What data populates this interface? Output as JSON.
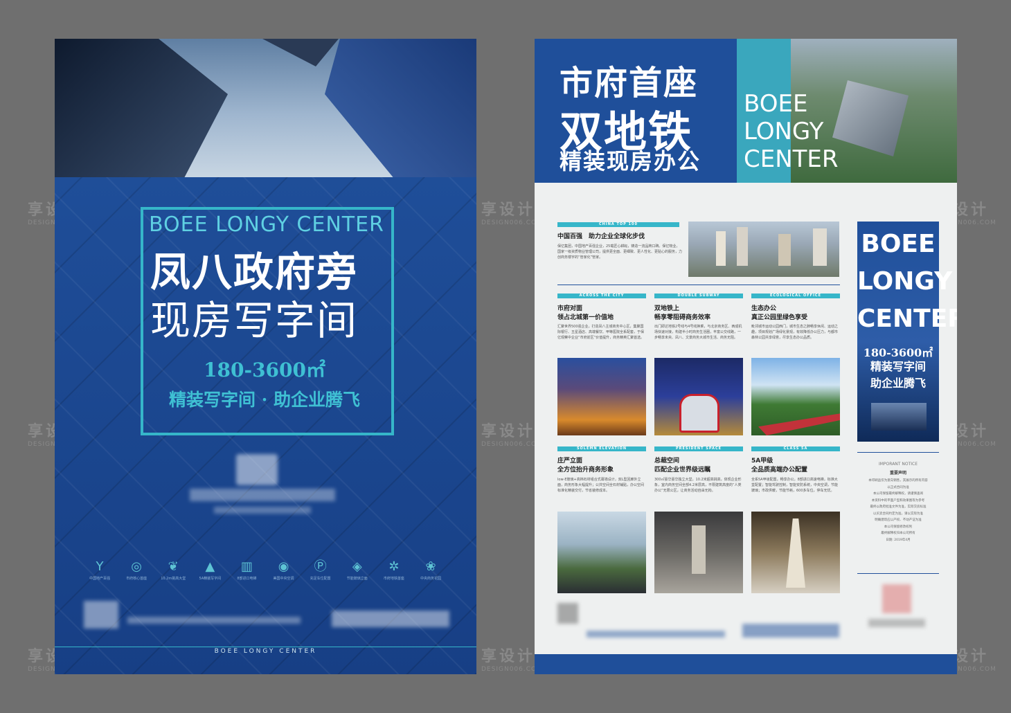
{
  "watermark": {
    "cn": "享设计",
    "en": "DESIGN006.COM"
  },
  "left_flyer": {
    "brand_en": "BOEE LONGY CENTER",
    "headline_1": "凤八政府旁",
    "headline_2": "现房写字间",
    "area": "180-3600㎡",
    "slogan": "精装写字间 · 助企业腾飞",
    "footer_brand": "BOEE LONGY CENTER",
    "icons": [
      {
        "icon": "y-shape-icon",
        "label": "中国地产百强"
      },
      {
        "icon": "grid-circle-icon",
        "label": "市府核心首座"
      },
      {
        "icon": "leaf-icon",
        "label": "10.2m挑高大堂"
      },
      {
        "icon": "triangles-icon",
        "label": "5A精装写字间"
      },
      {
        "icon": "building-icon",
        "label": "8部进口电梯"
      },
      {
        "icon": "target-icon",
        "label": "美国中央空调"
      },
      {
        "icon": "parking-icon",
        "label": "充足车位配置"
      },
      {
        "icon": "diamond-icon",
        "label": "节能玻璃立面"
      },
      {
        "icon": "stars-icon",
        "label": "市府地铁首座"
      },
      {
        "icon": "tree-icon",
        "label": "中央商务花园"
      }
    ]
  },
  "right_flyer": {
    "headline_1": "市府首座",
    "headline_2": "双地铁",
    "headline_3": "精装现房办公",
    "brand_en_1": "BOEE",
    "brand_en_2": "LONGY",
    "brand_en_3": "CENTER",
    "intro": {
      "bar": "CHINA TOP 100",
      "title": "中国百强　助力企业全球化步伐",
      "text": "保亿集团，中国地产百强企业，25载匠心耕耘，铸造一流品牌口碑。保亿物业，国家一级资质物业管理公司，提供更全面、更细致、更人性化、更贴心的服务，力创商务楼宇的“管家化”管家。"
    },
    "sections": [
      {
        "bar": "ACROSS THE CITY",
        "title1": "市府对面",
        "title2": "领占北城第一价值地",
        "text": "汇聚世界500强企业，打造凤八主城商务中心区，集聚国际银行、五星酒店、高端餐饮、甲等医院全系配套，于保亿观察中企业“市府前区”价值提升，商务精英汇聚首选。"
      },
      {
        "bar": "DOUBLE SUBWAY",
        "title1": "双地铁上",
        "title2": "畅享零阻碍商务效率",
        "text": "出门即达地铁2号线与4号线换乘，与北京商务区、西成机场快速对接，构建半小时商务生活圈，丰富公交线路，一步畅享未央、凤八、文景商务大城市生活、商务无阻。"
      },
      {
        "bar": "ECOLOGICAL OFFICE",
        "title1": "生态办公",
        "title2": "真正公园里绿色享受",
        "text": "毗邻城市运动公园西门，城市生态之肺畅享休闲、运动之趣，项目规划广场绿化景观，有效降低办公压力，与都市森林公园共享绿意，尽享生态办公品质。"
      },
      {
        "bar": "SOLEMN ELEVATION",
        "title1": "庄严立面",
        "title2": "全方位抬升商务形象",
        "text": "low-E玻璃+高档石材组合式幕墙设计，双L型回廊外立面，商务形象大幅提升；公共空间全石材铺贴，办公空间标准化精装交付，节省装修成本。"
      },
      {
        "bar": "PRESIDENT SPACE",
        "title1": "总裁空间",
        "title2": "匹配企业世界级远瞩",
        "text": "300㎡豪华豪华独立大堂，10.2米超高挑高，体现企业形象，室内商务空间全部4.2米层高，不限建筑高度的“人类办公”无限公区，让商务活动自由无拘。"
      },
      {
        "bar": "CLASS 5A",
        "title1": "5A甲级",
        "title2": "全品质高端办公配置",
        "text": "全系5A甲级配置，畅享办公，8部进口高速电梯，标准大堂配置；智能驾驶控制，智能安防系统，中央空调，节能玻璃；市政供暖，节能节耗，600多车位，停车无忧。"
      }
    ],
    "side_panel": {
      "brand_1": "BOEE",
      "brand_2": "LONGY",
      "brand_3": "CENTER",
      "area": "180-3600㎡",
      "slogan_1": "精装写字间",
      "slogan_2": "助企业腾飞"
    },
    "notice": {
      "label_en": "IMPORANT NOTICE",
      "label_cn": "重要声明",
      "lines": [
        "本印刷品仅为意向销售，其展示的所有内容",
        "以正式合同为准",
        "本公司保留最终解释权，请谨慎查阅",
        "本资料中的平面户型和效果图等为参考",
        "最终以政府批准文件为准，实际交房标准",
        "以买卖合同约定为准，请以实际为准",
        "明确建筑应以产权、不动产证为准",
        "本公司保留修改权利",
        "最终解释权归本公司所有",
        "日期: 2019年4月"
      ]
    }
  }
}
